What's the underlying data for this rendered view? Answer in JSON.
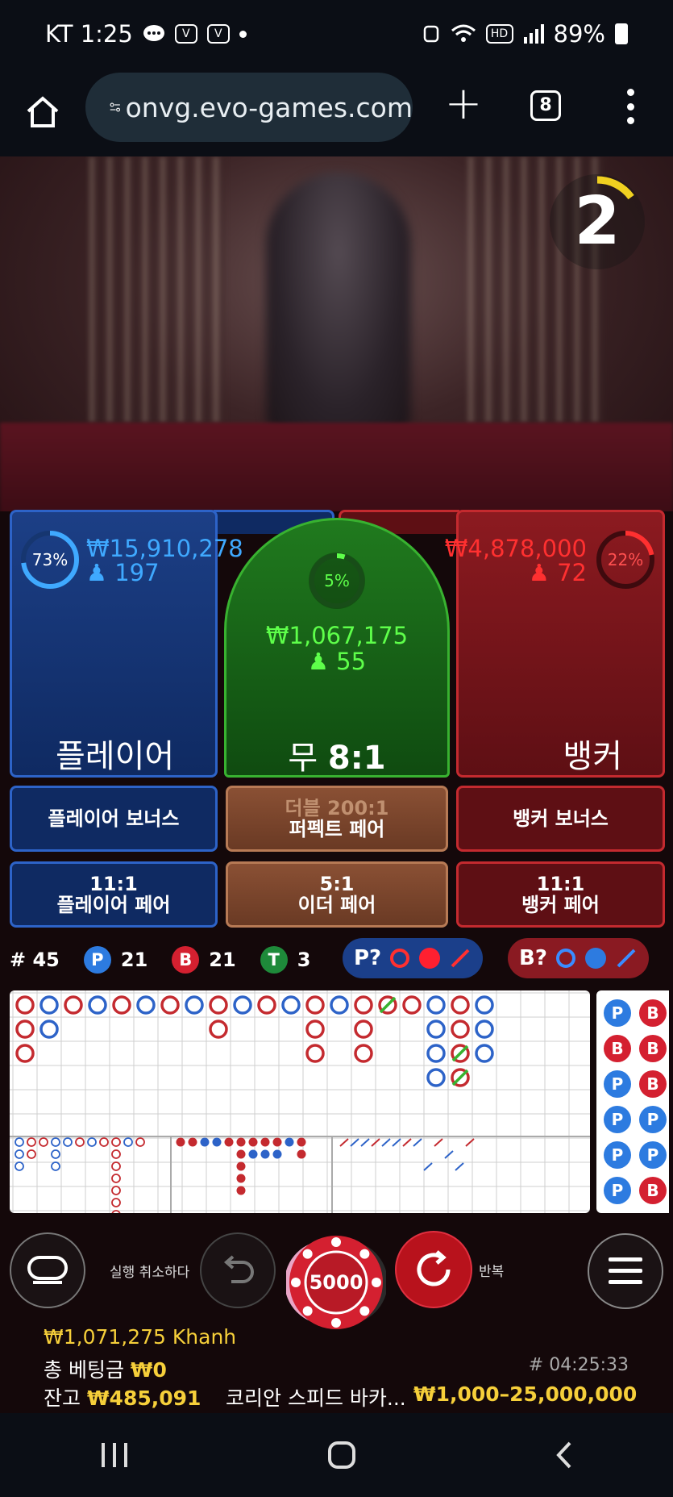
{
  "status_bar": {
    "carrier_time": "KT 1:25",
    "battery": "89%"
  },
  "browser": {
    "url": "onvg.evo-games.com",
    "tab_count": "8"
  },
  "timer": {
    "value": "2",
    "progress": 0.15
  },
  "player": {
    "percent": "73%",
    "percent_value": 0.73,
    "amount": "₩15,910,278",
    "players": "197",
    "label": "플레이어"
  },
  "tie": {
    "percent": "5%",
    "percent_value": 0.05,
    "amount": "₩1,067,175",
    "players": "55",
    "label": "무",
    "payout": "8:1"
  },
  "banker": {
    "percent": "22%",
    "percent_value": 0.22,
    "amount": "₩4,878,000",
    "players": "72",
    "label": "뱅커"
  },
  "side_bets": {
    "player_bonus": "플레이어 보너스",
    "perfect_pair_top": "더블 200:1",
    "perfect_pair": "퍼펙트 페어",
    "banker_bonus": "뱅커 보너스",
    "player_pair_payout": "11:1",
    "player_pair": "플레이어 페어",
    "either_pair_payout": "5:1",
    "either_pair": "이더 페어",
    "banker_pair_payout": "11:1",
    "banker_pair": "뱅커 페어"
  },
  "stats": {
    "round": "# 45",
    "p_label": "P",
    "p_count": "21",
    "b_label": "B",
    "b_count": "21",
    "t_label": "T",
    "t_count": "3"
  },
  "predictions": {
    "player": "P?",
    "banker": "B?"
  },
  "colors": {
    "player": "#2d63c8",
    "banker": "#c42a2f",
    "tie": "#38b230",
    "gold": "#f6cf3a",
    "grid": "#cfcfcf"
  },
  "bead_road": {
    "columns": [
      [
        "B",
        "B",
        "B"
      ],
      [
        "P",
        "P"
      ],
      [
        "B"
      ],
      [
        "P"
      ],
      [
        "B"
      ],
      [
        "P"
      ],
      [
        "B"
      ],
      [
        "P"
      ],
      [
        "B",
        "B"
      ],
      [
        "P"
      ],
      [
        "B"
      ],
      [
        "P"
      ],
      [
        "B",
        "B",
        "B"
      ],
      [
        "P"
      ],
      [
        "B",
        "B",
        "B"
      ],
      [
        "T"
      ],
      [
        "B"
      ],
      [
        "P",
        "P",
        "P",
        "P"
      ],
      [
        "B",
        "B",
        "T",
        "T"
      ],
      [
        "P",
        "P",
        "P"
      ]
    ]
  },
  "small_road": {
    "left": [
      [
        "P",
        "P",
        "P"
      ],
      [
        "B",
        "B"
      ],
      [
        "B"
      ],
      [
        "P",
        "P",
        "P"
      ],
      [
        "P"
      ],
      [
        "B"
      ],
      [
        "P"
      ],
      [
        "B"
      ],
      [
        "B",
        "B",
        "B",
        "B",
        "B",
        "B",
        "B",
        "B"
      ],
      [
        "P"
      ],
      [
        "B"
      ]
    ],
    "mid": [
      [
        "B"
      ],
      [
        "B"
      ],
      [
        "P"
      ],
      [
        "P"
      ],
      [
        "B"
      ],
      [
        "B",
        "B",
        "B",
        "B",
        "B"
      ],
      [
        "B",
        "P"
      ],
      [
        "B",
        "P"
      ],
      [
        "B",
        "P"
      ],
      [
        "P"
      ],
      [
        "B",
        "B"
      ]
    ],
    "right_strokes": 13
  },
  "side_road": [
    "P",
    "B",
    "P",
    "P",
    "P",
    "P"
  ],
  "side_road_right": [
    "B",
    "B",
    "B",
    "P",
    "P",
    "B"
  ],
  "controls": {
    "undo_label": "실행 취소하다",
    "chip_value": "5000",
    "repeat_label": "반복"
  },
  "footer": {
    "balance_user": "₩1,071,275 Khanh",
    "total_bet_label": "총 베팅금",
    "total_bet_value": "₩0",
    "game_id": "# 04:25:33",
    "balance_label": "잔고",
    "balance_value": "₩485,091",
    "table_name": "코리안 스피드 바카...",
    "limits": "₩1,000–25,000,000"
  }
}
